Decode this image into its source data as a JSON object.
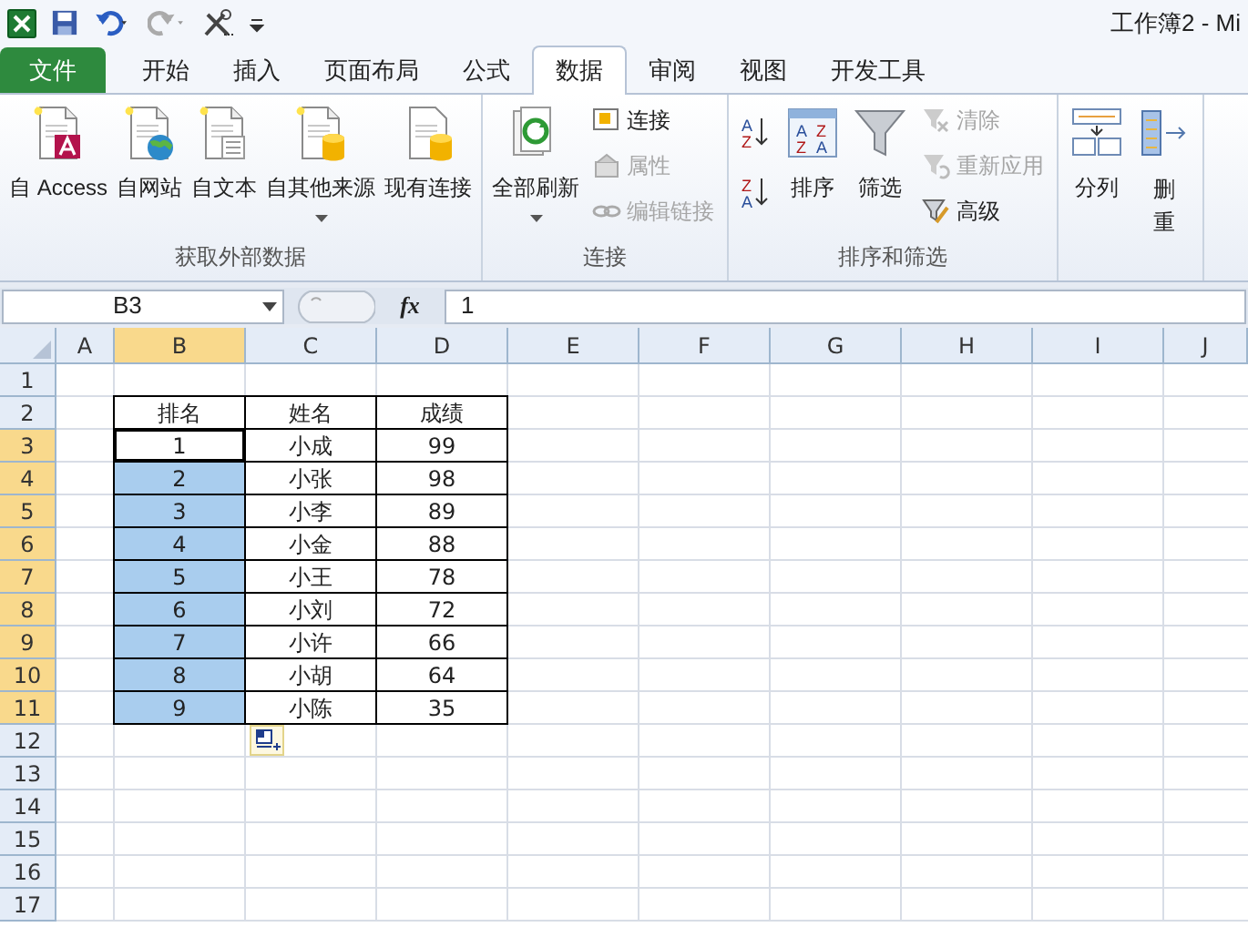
{
  "title_bar": {
    "title": "工作簿2 - Mi"
  },
  "tabs": [
    {
      "label": "文件",
      "kind": "file",
      "selected": false
    },
    {
      "label": "开始",
      "kind": "normal",
      "selected": false
    },
    {
      "label": "插入",
      "kind": "normal",
      "selected": false
    },
    {
      "label": "页面布局",
      "kind": "normal",
      "selected": false
    },
    {
      "label": "公式",
      "kind": "normal",
      "selected": false
    },
    {
      "label": "数据",
      "kind": "normal",
      "selected": true
    },
    {
      "label": "审阅",
      "kind": "normal",
      "selected": false
    },
    {
      "label": "视图",
      "kind": "normal",
      "selected": false
    },
    {
      "label": "开发工具",
      "kind": "normal",
      "selected": false
    }
  ],
  "ribbon": {
    "groups": [
      {
        "label": "获取外部数据",
        "commands": [
          {
            "kind": "large",
            "label": "自 Access",
            "disabled": false,
            "dropdown": false
          },
          {
            "kind": "large",
            "label": "自网站",
            "disabled": false,
            "dropdown": false
          },
          {
            "kind": "large",
            "label": "自文本",
            "disabled": false,
            "dropdown": false
          },
          {
            "kind": "large",
            "label": "自其他来源",
            "disabled": false,
            "dropdown": true
          },
          {
            "kind": "large",
            "label": "现有连接",
            "disabled": false,
            "dropdown": false
          }
        ]
      },
      {
        "label": "连接",
        "commands": [
          {
            "kind": "large",
            "label": "全部刷新",
            "disabled": false,
            "dropdown": true
          },
          {
            "kind": "small",
            "label": "连接",
            "disabled": false
          },
          {
            "kind": "small",
            "label": "属性",
            "disabled": true
          },
          {
            "kind": "small",
            "label": "编辑链接",
            "disabled": true
          }
        ]
      },
      {
        "label": "排序和筛选",
        "commands": [
          {
            "kind": "sort_pair",
            "ascending": [
              "A",
              "Z"
            ],
            "descending": [
              "Z",
              "A"
            ]
          },
          {
            "kind": "large",
            "label": "排序",
            "disabled": false,
            "dropdown": false,
            "icon_letters": [
              "A",
              "Z",
              "Z",
              "A"
            ]
          },
          {
            "kind": "large",
            "label": "筛选",
            "disabled": false,
            "dropdown": false
          },
          {
            "kind": "small",
            "label": "清除",
            "disabled": true
          },
          {
            "kind": "small",
            "label": "重新应用",
            "disabled": true
          },
          {
            "kind": "small",
            "label": "高级",
            "disabled": false
          }
        ]
      },
      {
        "commands": [
          {
            "kind": "large",
            "label": "分列",
            "disabled": false,
            "dropdown": false
          },
          {
            "kind": "large_stacked",
            "label": "删重",
            "disabled": false,
            "dropdown": false
          }
        ]
      }
    ]
  },
  "formula_bar": {
    "name_box": "B3",
    "fx": "fx",
    "value": "1"
  },
  "sheet": {
    "columns": [
      {
        "label": "A",
        "selected": false
      },
      {
        "label": "B",
        "selected": true
      },
      {
        "label": "C",
        "selected": false
      },
      {
        "label": "D",
        "selected": false
      },
      {
        "label": "E",
        "selected": false
      },
      {
        "label": "F",
        "selected": false
      },
      {
        "label": "G",
        "selected": false
      },
      {
        "label": "H",
        "selected": false
      },
      {
        "label": "I",
        "selected": false
      },
      {
        "label": "J",
        "selected": false
      }
    ],
    "rows": [
      {
        "label": "1",
        "selected": false,
        "cells": []
      },
      {
        "label": "2",
        "selected": false,
        "cells": [
          {
            "text": ""
          },
          {
            "text": "排名",
            "selected": false
          },
          {
            "text": "姓名",
            "selected": false
          },
          {
            "text": "成绩",
            "selected": false
          }
        ]
      },
      {
        "label": "3",
        "selected": true,
        "cells": [
          {
            "text": ""
          },
          {
            "text": "1",
            "active": true
          },
          {
            "text": "小成",
            "selected": false
          },
          {
            "text": "99",
            "selected": false
          }
        ]
      },
      {
        "label": "4",
        "selected": true,
        "cells": [
          {
            "text": ""
          },
          {
            "text": "2",
            "selected": true
          },
          {
            "text": "小张",
            "selected": false
          },
          {
            "text": "98",
            "selected": false
          }
        ]
      },
      {
        "label": "5",
        "selected": true,
        "cells": [
          {
            "text": ""
          },
          {
            "text": "3",
            "selected": true
          },
          {
            "text": "小李",
            "selected": false
          },
          {
            "text": "89",
            "selected": false
          }
        ]
      },
      {
        "label": "6",
        "selected": true,
        "cells": [
          {
            "text": ""
          },
          {
            "text": "4",
            "selected": true
          },
          {
            "text": "小金",
            "selected": false
          },
          {
            "text": "88",
            "selected": false
          }
        ]
      },
      {
        "label": "7",
        "selected": true,
        "cells": [
          {
            "text": ""
          },
          {
            "text": "5",
            "selected": true
          },
          {
            "text": "小王",
            "selected": false
          },
          {
            "text": "78",
            "selected": false
          }
        ]
      },
      {
        "label": "8",
        "selected": true,
        "cells": [
          {
            "text": ""
          },
          {
            "text": "6",
            "selected": true
          },
          {
            "text": "小刘",
            "selected": false
          },
          {
            "text": "72",
            "selected": false
          }
        ]
      },
      {
        "label": "9",
        "selected": true,
        "cells": [
          {
            "text": ""
          },
          {
            "text": "7",
            "selected": true
          },
          {
            "text": "小许",
            "selected": false
          },
          {
            "text": "66",
            "selected": false
          }
        ]
      },
      {
        "label": "10",
        "selected": true,
        "cells": [
          {
            "text": ""
          },
          {
            "text": "8",
            "selected": true
          },
          {
            "text": "小胡",
            "selected": false
          },
          {
            "text": "64",
            "selected": false
          }
        ]
      },
      {
        "label": "11",
        "selected": true,
        "cells": [
          {
            "text": ""
          },
          {
            "text": "9",
            "selected": true
          },
          {
            "text": "小陈",
            "selected": false
          },
          {
            "text": "35",
            "selected": false
          }
        ]
      },
      {
        "label": "12",
        "selected": false,
        "cells": []
      },
      {
        "label": "13",
        "selected": false,
        "cells": []
      },
      {
        "label": "14",
        "selected": false,
        "cells": []
      },
      {
        "label": "15",
        "selected": false,
        "cells": []
      },
      {
        "label": "16",
        "selected": false,
        "cells": []
      },
      {
        "label": "17",
        "selected": false,
        "cells": []
      }
    ]
  }
}
